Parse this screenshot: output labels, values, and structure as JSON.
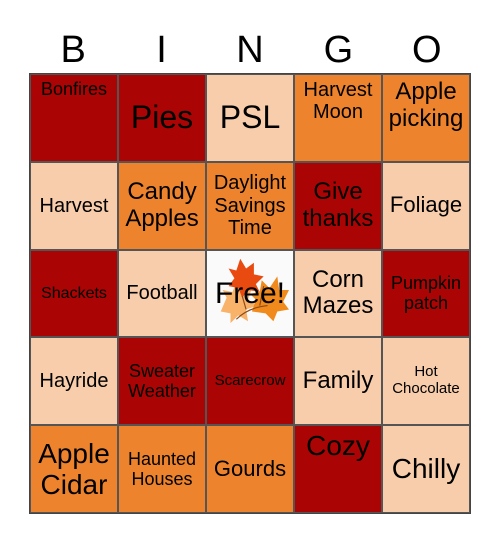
{
  "header": {
    "letters": [
      "B",
      "I",
      "N",
      "G",
      "O"
    ]
  },
  "colors": {
    "dark_red": "#AA0404",
    "orange": "#EE832E",
    "peach": "#F8CDAB"
  },
  "cells": [
    [
      "Bonfires",
      "Pies",
      "PSL",
      "Harvest Moon",
      "Apple picking"
    ],
    [
      "Harvest",
      "Candy Apples",
      "Daylight Savings Time",
      "Give thanks",
      "Foliage"
    ],
    [
      "Shackets",
      "Football",
      "Free!",
      "Corn Mazes",
      "Pumpkin patch"
    ],
    [
      "Hayride",
      "Sweater Weather",
      "Scarecrow",
      "Family",
      "Hot Chocolate"
    ],
    [
      "Apple Cidar",
      "Haunted Houses",
      "Gourds",
      "Cozy",
      "Chilly"
    ]
  ],
  "free_cell": {
    "label": "Free!",
    "icon": "autumn-leaves-icon"
  }
}
